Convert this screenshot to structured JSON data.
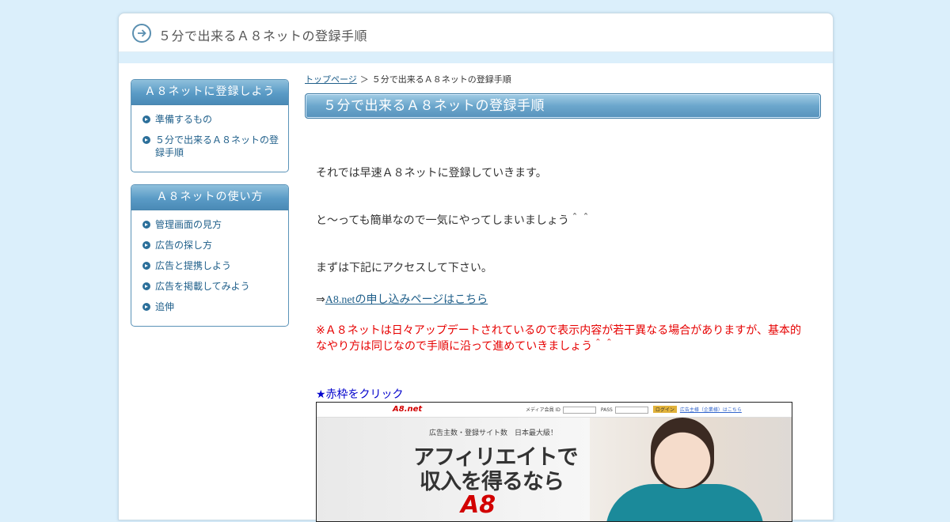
{
  "header": {
    "title": "５分で出来るＡ８ネットの登録手順"
  },
  "sidebar": {
    "boxes": [
      {
        "title": "Ａ８ネットに登録しよう",
        "items": [
          {
            "label": "準備するもの"
          },
          {
            "label": "５分で出来るＡ８ネットの登録手順"
          }
        ]
      },
      {
        "title": "Ａ８ネットの使い方",
        "items": [
          {
            "label": "管理画面の見方"
          },
          {
            "label": "広告の探し方"
          },
          {
            "label": "広告と提携しよう"
          },
          {
            "label": "広告を掲載してみよう"
          },
          {
            "label": "追伸"
          }
        ]
      }
    ]
  },
  "breadcrumb": {
    "home": "トップページ",
    "separator": "＞",
    "current": "５分で出来るＡ８ネットの登録手順"
  },
  "main": {
    "title": "５分で出来るＡ８ネットの登録手順",
    "p1": "それでは早速Ａ８ネットに登録していきます。",
    "p2": "と～っても簡単なので一気にやってしまいましょう＾＾",
    "p3": "まずは下記にアクセスして下さい。",
    "link_prefix": "⇒",
    "link_text": "A8.netの申し込みページはこちら",
    "notice": "※Ａ８ネットは日々アップデートされているので表示内容が若干異なる場合がありますが、基本的なやり方は同じなので手順に沿って進めていきましょう＾＾",
    "step_label": "★赤枠をクリック"
  },
  "screenshot": {
    "logo": "A8.net",
    "media_label": "メディア会員 ID",
    "pass_label": "PASS",
    "login_button": "ログイン",
    "advertiser_link": "広告主様（企業様）はこちら",
    "subcopy": "広告主数・登録サイト数　日本最大級！",
    "headline1": "アフィリエイトで",
    "headline2": "収入を得るなら",
    "big_logo": "A8"
  },
  "colors": {
    "accent": "#5a9bc6",
    "link": "#1f5f8a",
    "notice": "#e60000",
    "step": "#0000cc"
  }
}
